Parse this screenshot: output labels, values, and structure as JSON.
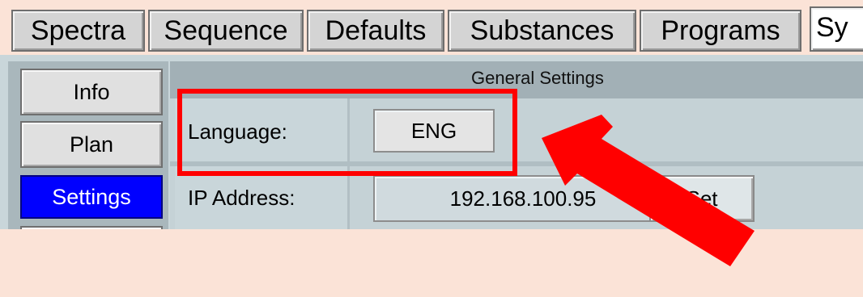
{
  "tabs": [
    {
      "label": "Spectra"
    },
    {
      "label": "Sequence"
    },
    {
      "label": "Defaults"
    },
    {
      "label": "Substances"
    },
    {
      "label": "Programs"
    },
    {
      "label": "Sy"
    }
  ],
  "sidebar": {
    "items": [
      {
        "label": "Info"
      },
      {
        "label": "Plan"
      },
      {
        "label": "Settings",
        "selected": true
      }
    ]
  },
  "general_settings": {
    "title": "General Settings",
    "language_label": "Language:",
    "language_value": "ENG",
    "ip_label": "IP Address:",
    "ip_value": "192.168.100.95",
    "set_label": "Set"
  },
  "annotation": {
    "highlight_color": "#ff0000",
    "arrow_color": "#ff0000"
  }
}
